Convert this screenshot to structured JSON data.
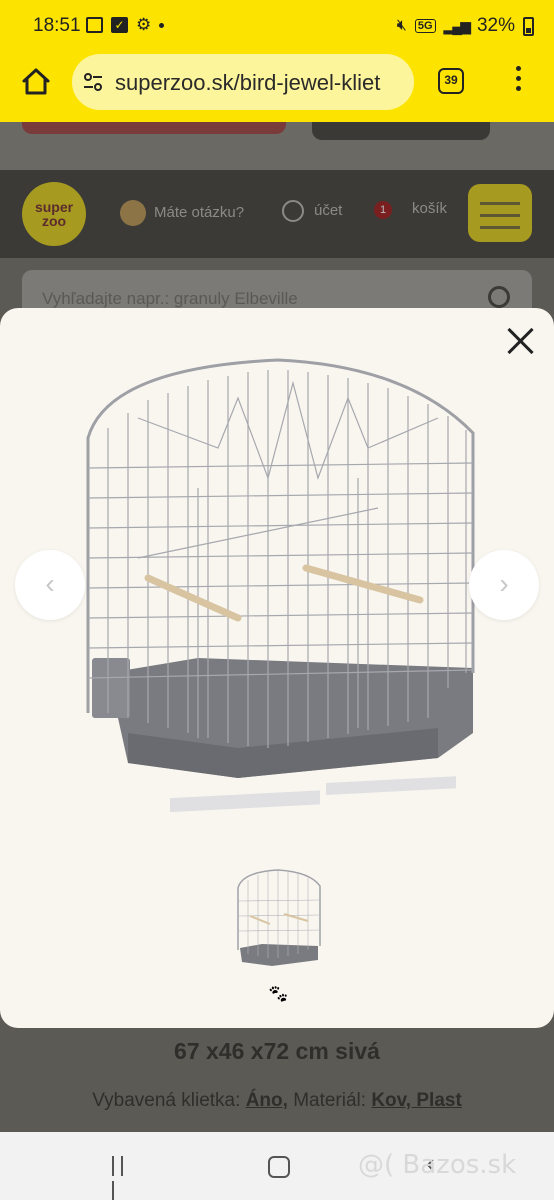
{
  "status": {
    "time": "18:51",
    "network": "5G",
    "battery": "32%"
  },
  "browser": {
    "url": "superzoo.sk/bird-jewel-kliet",
    "tab_count": "39"
  },
  "site": {
    "logo_top": "super",
    "logo_bottom": "zoo",
    "question_label": "Máte otázku?",
    "account_label": "účet",
    "cart_count": "1",
    "cart_label": "košík",
    "search_placeholder": "Vyhľadajte napr.: granuly Elbeville",
    "product_title": "67 x46 x72 cm sivá",
    "equipped_label": "Vybavená klietka:",
    "equipped_value": "Áno,",
    "material_label": "Materiál:",
    "material_value": "Kov, Plast"
  },
  "gallery": {
    "prev_glyph": "‹",
    "next_glyph": "›"
  },
  "watermark": "@( Bazos.sk",
  "colors": {
    "chrome": "#fde400",
    "brand_yellow": "#a79a20",
    "modal_bg": "#f9f6f0"
  }
}
